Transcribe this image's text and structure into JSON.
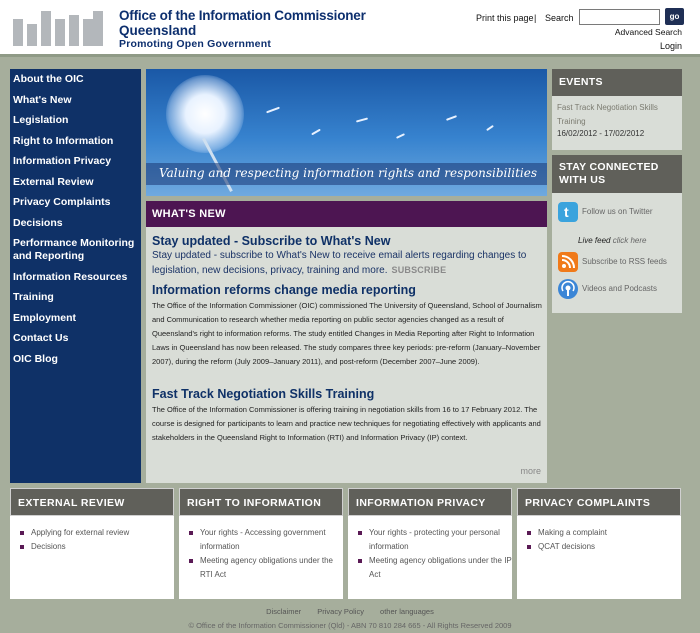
{
  "header": {
    "org_title": "Office of the Information Commissioner",
    "org_subtitle": "Queensland",
    "tagline": "Promoting Open Government",
    "print_label": "Print this page",
    "separator": "|",
    "search_label": "Search",
    "search_value": "",
    "go_label": "go",
    "advanced_search": "Advanced Search",
    "login": "Login"
  },
  "leftnav": [
    "About the OIC",
    "What's New",
    "Legislation",
    "Right to Information",
    "Information Privacy",
    "External Review",
    "Privacy Complaints",
    "Decisions",
    "Performance Monitoring and Reporting",
    "Information Resources",
    "Training",
    "Employment",
    "Contact Us",
    "OIC Blog"
  ],
  "banner": {
    "caption": "Valuing and respecting information rights and responsibilities"
  },
  "whatsnew": {
    "heading": "WHAT'S NEW",
    "items": [
      {
        "title": "Stay updated - Subscribe to What's New",
        "body": "Stay updated - subscribe to What's New to receive email alerts regarding changes to legislation, new decisions, privacy, training and more.",
        "action": "SUBSCRIBE"
      },
      {
        "title": "Information reforms change media reporting",
        "body": "The Office of the Information Commissioner (OIC) commissioned The University of Queensland, School of Journalism and Communication to research  whether media reporting on public sector agencies changed as a result of Queensland's right to information reforms. The study entitled Changes in Media Reporting after Right to Information Laws in Queensland has now been released. The study compares three key periods: pre-reform (January–November 2007), during the reform (July 2009–January 2011), and post-reform (December 2007–June 2009)."
      },
      {
        "title": "Fast Track Negotiation Skills Training",
        "body": "The Office of the Information Commissioner is offering training in negotiation skills from 16 to 17 February 2012. The course is designed for participants to learn and practice new techniques for negotiating effectively with applicants and stakeholders in the Queensland Right to Information (RTI) and Information Privacy (IP) context."
      }
    ],
    "more": "more"
  },
  "events": {
    "heading": "EVENTS",
    "title": "Fast Track Negotiation Skills Training",
    "dates": "16/02/2012 - 17/02/2012"
  },
  "connect": {
    "heading": "STAY CONNECTED WITH US",
    "twitter": "Follow us on Twitter",
    "livefeed_label": "Live feed",
    "livefeed_link": "click here",
    "rss": "Subscribe to RSS feeds",
    "podcasts": "Videos and Podcasts"
  },
  "boxes": [
    {
      "heading": "EXTERNAL REVIEW",
      "links": [
        "Applying for external review",
        "Decisions"
      ]
    },
    {
      "heading": "RIGHT TO INFORMATION",
      "links": [
        "Your rights - Accessing government information",
        "Meeting agency obligations under the RTI Act"
      ]
    },
    {
      "heading": "INFORMATION PRIVACY",
      "links": [
        "Your rights - protecting your personal information",
        "Meeting agency obligations under the IP Act"
      ]
    },
    {
      "heading": "PRIVACY COMPLAINTS",
      "links": [
        "Making a complaint",
        "QCAT decisions"
      ]
    }
  ],
  "footer": {
    "links": [
      "Disclaimer",
      "Privacy Policy",
      "other languages"
    ],
    "copyright": "© Office of the Information Commissioner (Qld) - ABN 70 810 284 665 - All Rights Reserved 2009"
  }
}
